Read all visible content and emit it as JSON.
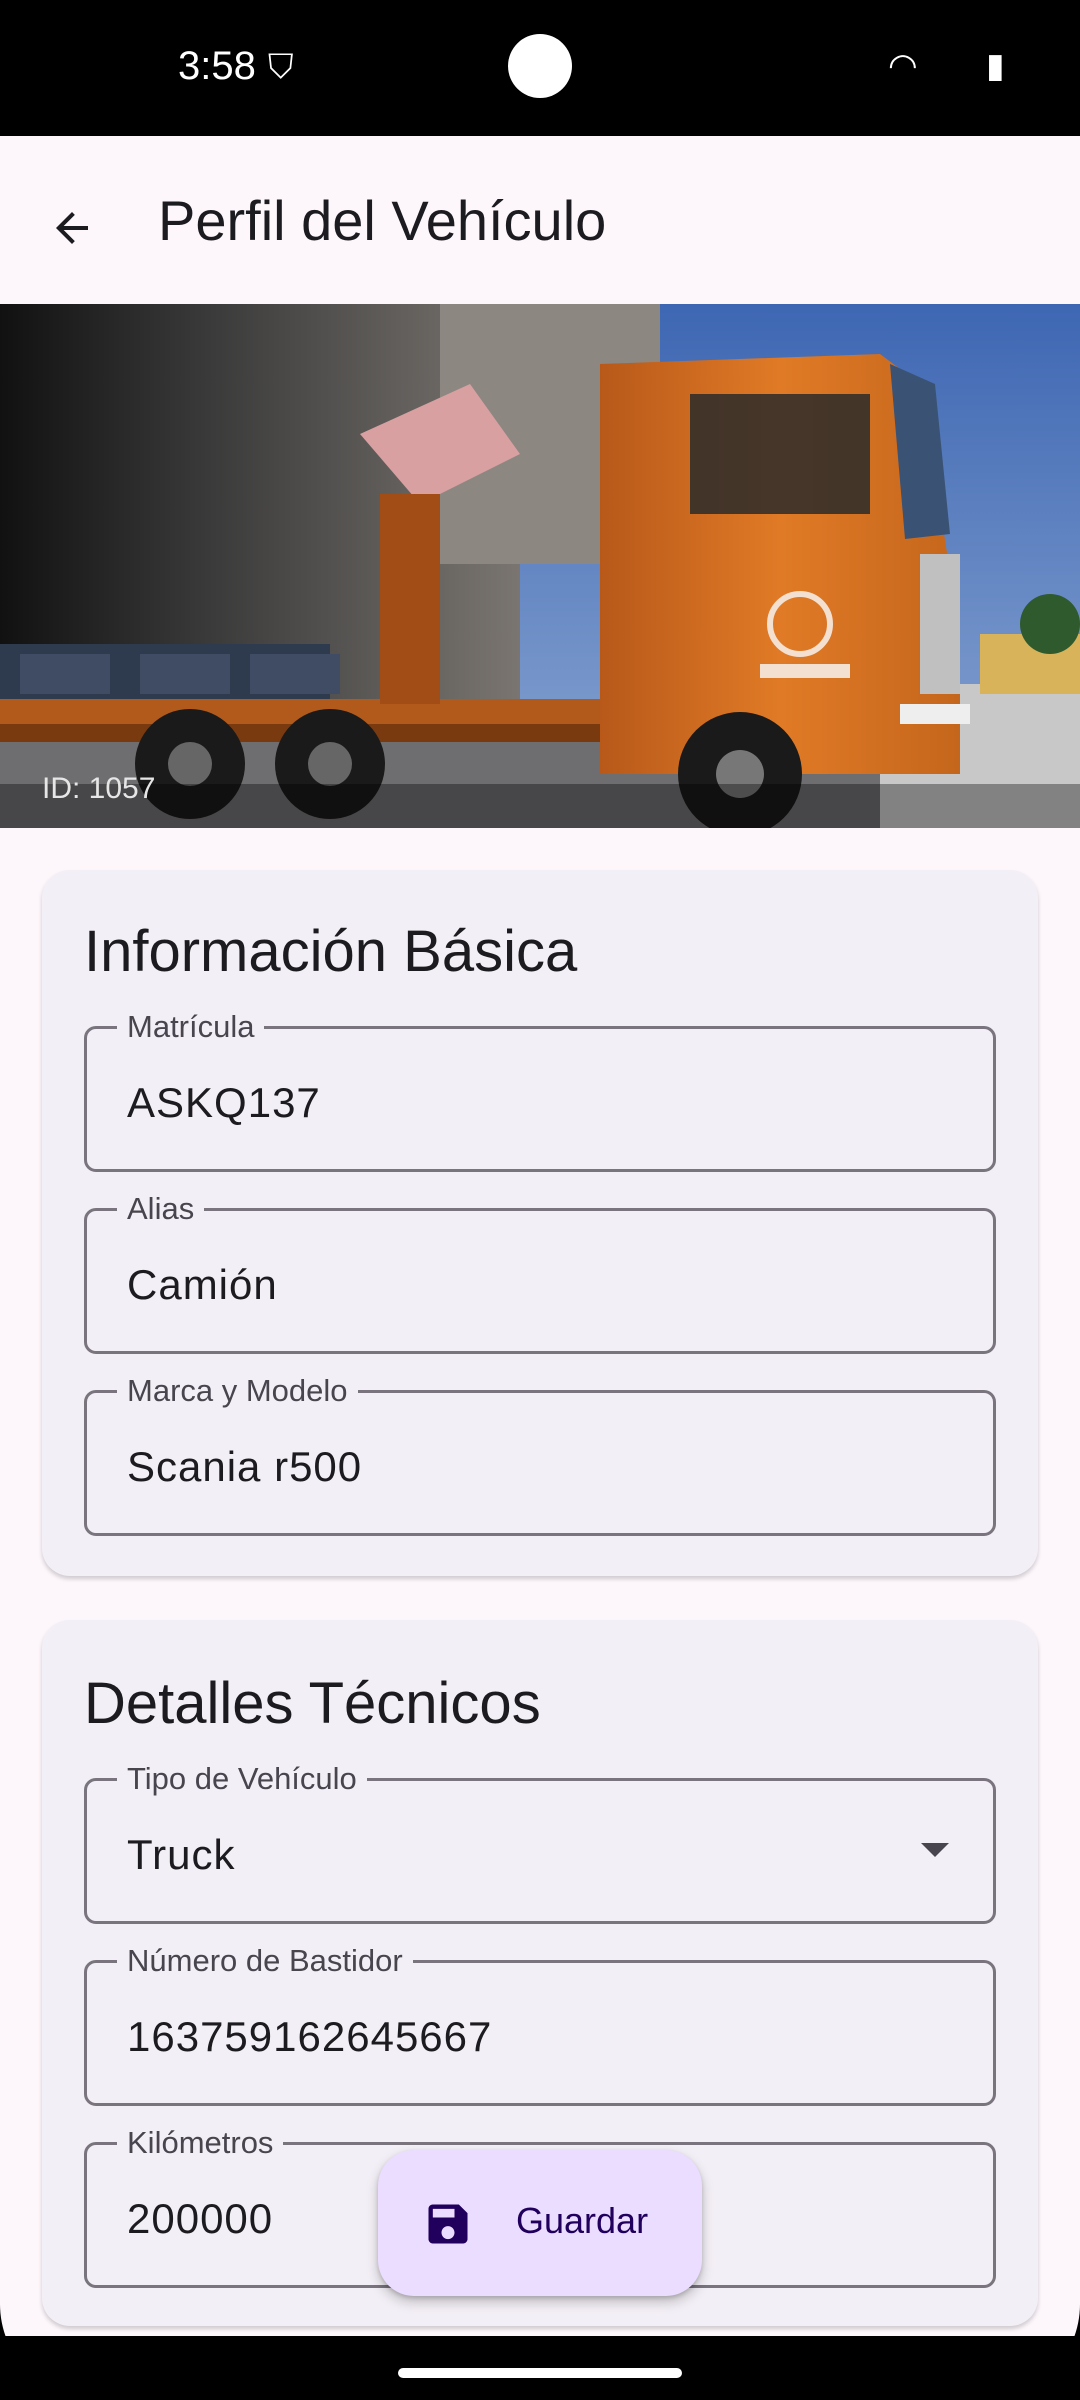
{
  "status": {
    "time": "3:58",
    "shield_icon": "shield-icon",
    "wifi_icon": "wifi-icon",
    "battery_icon": "battery-icon"
  },
  "appbar": {
    "title": "Perfil del Vehículo",
    "back_icon": "arrow-back-icon"
  },
  "hero": {
    "id_label": "ID: 1057"
  },
  "basic_info": {
    "title": "Información Básica",
    "fields": [
      {
        "label": "Matrícula",
        "value": "ASKQ137"
      },
      {
        "label": "Alias",
        "value": "Camión"
      },
      {
        "label": "Marca y Modelo",
        "value": "Scania r500"
      }
    ]
  },
  "technical": {
    "title": "Detalles Técnicos",
    "vehicle_type": {
      "label": "Tipo de Vehículo",
      "value": "Truck"
    },
    "chassis": {
      "label": "Número de Bastidor",
      "value": "163759162645667"
    },
    "km": {
      "label": "Kilómetros",
      "value": "200000"
    }
  },
  "fab": {
    "label": "Guardar",
    "icon": "save-icon"
  },
  "colors": {
    "background": "#fdf7fc",
    "card": "#f3eff6",
    "fab": "#eaddff",
    "fab_text": "#21005d",
    "outline": "#79747e"
  }
}
